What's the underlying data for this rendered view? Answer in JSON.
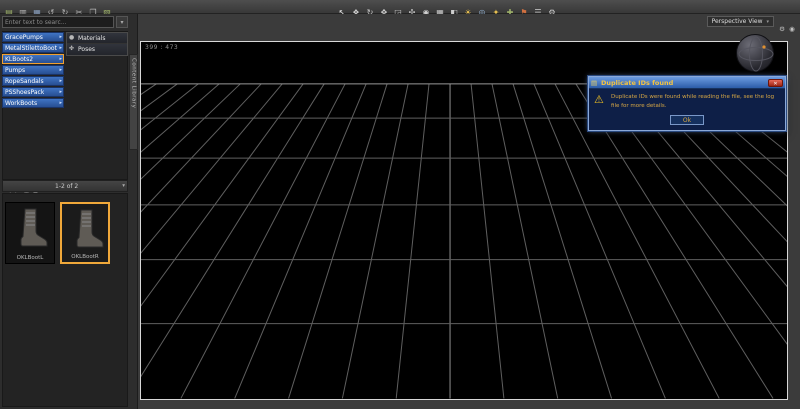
{
  "toolbar": {
    "left_icons": [
      {
        "name": "new-file-icon",
        "glyph": "▤",
        "color": "#9fb36a"
      },
      {
        "name": "open-file-icon",
        "glyph": "▥",
        "color": "#b8b8b8"
      },
      {
        "name": "save-file-icon",
        "glyph": "▦",
        "color": "#8aa0c0"
      },
      {
        "name": "undo-icon",
        "glyph": "↺",
        "color": "#b8b8b8"
      },
      {
        "name": "redo-icon",
        "glyph": "↻",
        "color": "#b8b8b8"
      },
      {
        "name": "cut-icon",
        "glyph": "✂",
        "color": "#b8b8b8"
      },
      {
        "name": "copy-icon",
        "glyph": "❐",
        "color": "#b8b8b8"
      },
      {
        "name": "paste-icon",
        "glyph": "▧",
        "color": "#9fb36a"
      }
    ],
    "center_icons": [
      {
        "name": "pointer-tool-icon",
        "glyph": "↖",
        "color": "#f2f2f2"
      },
      {
        "name": "universal-tool-icon",
        "glyph": "❖",
        "color": "#cfcfcf"
      },
      {
        "name": "rotate-tool-icon",
        "glyph": "↻",
        "color": "#cfcfcf"
      },
      {
        "name": "translate-tool-icon",
        "glyph": "✥",
        "color": "#cfcfcf"
      },
      {
        "name": "scale-tool-icon",
        "glyph": "◲",
        "color": "#cfcfcf"
      },
      {
        "name": "active-pose-tool-icon",
        "glyph": "✣",
        "color": "#cfcfcf"
      },
      {
        "name": "node-selection-icon",
        "glyph": "◉",
        "color": "#cfcfcf"
      },
      {
        "name": "surface-selection-icon",
        "glyph": "▦",
        "color": "#cfcfcf"
      },
      {
        "name": "spot-render-icon",
        "glyph": "◧",
        "color": "#cfcfcf"
      },
      {
        "name": "render-icon",
        "glyph": "☀",
        "color": "#e8c050"
      },
      {
        "name": "camera-icon",
        "glyph": "◎",
        "color": "#9ab8d8"
      },
      {
        "name": "light-icon",
        "glyph": "✦",
        "color": "#e8c050"
      },
      {
        "name": "create-node-icon",
        "glyph": "✚",
        "color": "#9fb36a"
      },
      {
        "name": "flag-icon",
        "glyph": "⚑",
        "color": "#d07040"
      },
      {
        "name": "scene-list-icon",
        "glyph": "☰",
        "color": "#cfcfcf"
      },
      {
        "name": "settings-icon",
        "glyph": "⚙",
        "color": "#cfcfcf"
      }
    ]
  },
  "content_panel": {
    "search_placeholder": "Enter text to searc...",
    "search_dd_glyph": "▾",
    "tab_label": "Content Library",
    "items": [
      {
        "label": "GracePumps",
        "selected": false
      },
      {
        "label": "MetalStilettoBoots",
        "selected": false
      },
      {
        "label": "KLBoots2",
        "selected": true
      },
      {
        "label": "Pumps",
        "selected": false
      },
      {
        "label": "RopeSandals",
        "selected": false
      },
      {
        "label": "PSShoesPack",
        "selected": false
      },
      {
        "label": "WorkBoots",
        "selected": false
      }
    ],
    "flyout": {
      "items": [
        {
          "label": "Materials",
          "glyph": "●",
          "icon_name": "materials-icon"
        },
        {
          "label": "Poses",
          "glyph": "✤",
          "icon_name": "poses-icon"
        }
      ]
    },
    "thumb_toolbar_icons": [
      {
        "name": "prev-page-icon",
        "glyph": "◀",
        "color": "#b0b0b0"
      },
      {
        "name": "next-page-icon",
        "glyph": "▶",
        "color": "#b0b0b0"
      },
      {
        "name": "view-grid-icon",
        "glyph": "▦",
        "color": "#b0b0b0"
      },
      {
        "name": "view-list-icon",
        "glyph": "☰",
        "color": "#b0b0b0"
      }
    ],
    "pagination": "1-2 of 2",
    "sort_glyph": "▾",
    "thumbnails": [
      {
        "label": "OKLBootL",
        "selected": false
      },
      {
        "label": "OKLBootR",
        "selected": true
      }
    ]
  },
  "viewport": {
    "coords": "399 : 473",
    "view_selector": "Perspective View",
    "view_selector_caret": "▾",
    "icons": [
      {
        "name": "viewport-settings-icon",
        "glyph": "⚙",
        "color": "#c0c0c0"
      },
      {
        "name": "viewport-options-icon",
        "glyph": "◉",
        "color": "#c0c0c0"
      }
    ]
  },
  "dialog": {
    "title": "Duplicate IDs found",
    "title_icon_glyph": "▤",
    "warning_glyph": "⚠",
    "message": "Duplicate IDs were found while reading the file, see the log file for more details.",
    "ok_label": "Ok",
    "close_label": "✕"
  },
  "colors": {
    "selection_orange": "#f0a83a",
    "item_blue": "#3f74c4",
    "dialog_title_blue": "#2c5ca8",
    "dialog_text_amber": "#d8a845"
  }
}
